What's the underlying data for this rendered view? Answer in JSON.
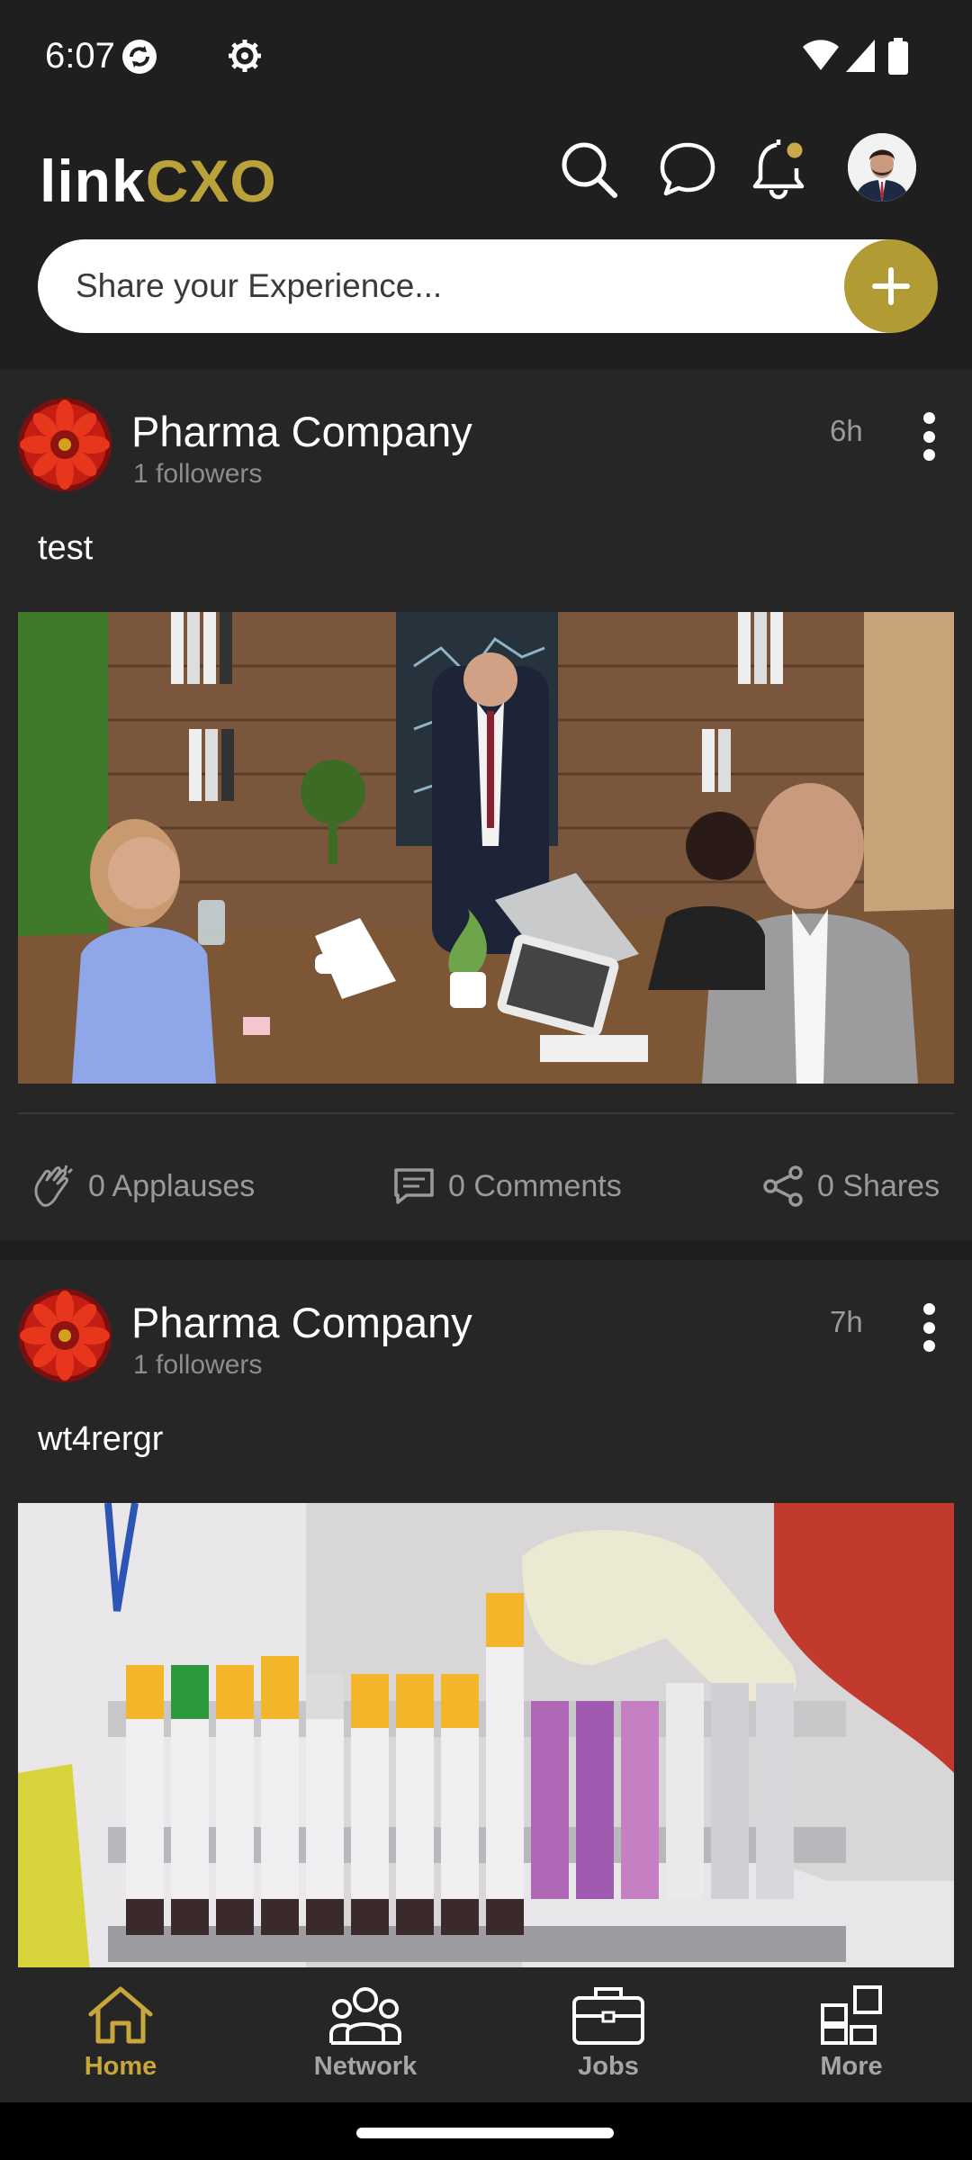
{
  "status_bar": {
    "time": "6:07"
  },
  "header": {
    "logo_part1": "link",
    "logo_part2": "CXO",
    "search_icon": "search-icon",
    "chat_icon": "chat-icon",
    "notification_icon": "bell-icon",
    "avatar": "avatar",
    "share_placeholder": "Share your Experience...",
    "add_icon": "plus-icon"
  },
  "posts": [
    {
      "company": "Pharma Company",
      "followers": "1 followers",
      "time": "6h",
      "text": "test",
      "applauses": "0 Applauses",
      "comments": "0 Comments",
      "shares": "0 Shares"
    },
    {
      "company": "Pharma Company",
      "followers": "1 followers",
      "time": "7h",
      "text": "wt4rergr"
    }
  ],
  "nav": {
    "home": "Home",
    "network": "Network",
    "jobs": "Jobs",
    "more": "More"
  },
  "colors": {
    "accent": "#b29a35",
    "background": "#1f1f1f",
    "card": "#262626"
  }
}
